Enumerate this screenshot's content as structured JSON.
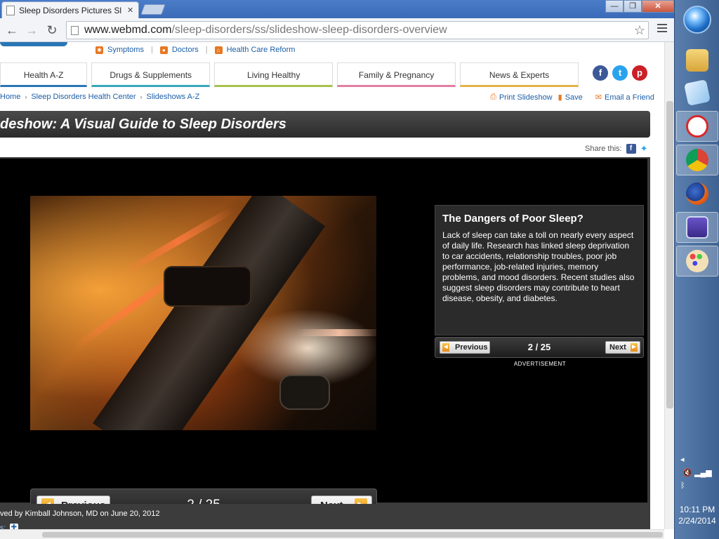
{
  "browser": {
    "tab_title": "Sleep Disorders Pictures Sl",
    "tab_close": "✕",
    "url_domain": "www.webmd.com",
    "url_path": "/sleep-disorders/ss/slideshow-sleep-disorders-overview",
    "window_buttons": [
      "—",
      "❐",
      "✕"
    ]
  },
  "site": {
    "top_links": [
      {
        "label": "Symptoms"
      },
      {
        "label": "Doctors"
      },
      {
        "label": "Health Care Reform"
      }
    ],
    "nav_tabs": [
      {
        "label": "Health A-Z"
      },
      {
        "label": "Drugs & Supplements"
      },
      {
        "label": "Living Healthy"
      },
      {
        "label": "Family & Pregnancy"
      },
      {
        "label": "News & Experts"
      }
    ],
    "social": [
      "f",
      "t",
      "p"
    ]
  },
  "breadcrumb": {
    "items": [
      "Home",
      "Sleep Disorders Health Center",
      "Slideshows A-Z"
    ]
  },
  "actions": {
    "print": "Print Slideshow",
    "save": "Save",
    "email": "Email a Friend"
  },
  "slideshow": {
    "title": "deshow: A Visual Guide to Sleep Disorders",
    "share_label": "Share this:",
    "slide_title": "The Dangers of Poor Sleep?",
    "slide_text": "Lack of sleep can take a toll on nearly every aspect of daily life. Research has linked sleep deprivation to car accidents, relationship troubles, poor job performance, job-related injuries, memory problems, and mood disorders. Recent studies also suggest sleep disorders may contribute to heart disease, obesity, and diabetes.",
    "previous_label": "Previous",
    "next_label": "Next",
    "counter": "2 / 25",
    "ad_label": "ADVERTISEMENT",
    "reviewed_by": "ved by Kimball Johnson, MD on June 20, 2012",
    "sources_label": "s:"
  },
  "taskbar": {
    "time": "10:11 PM",
    "date": "2/24/2014"
  },
  "colors": {
    "webmd_blue": "#2a76b6",
    "link_blue": "#1d5fa6",
    "accent_orange": "#e77722"
  }
}
